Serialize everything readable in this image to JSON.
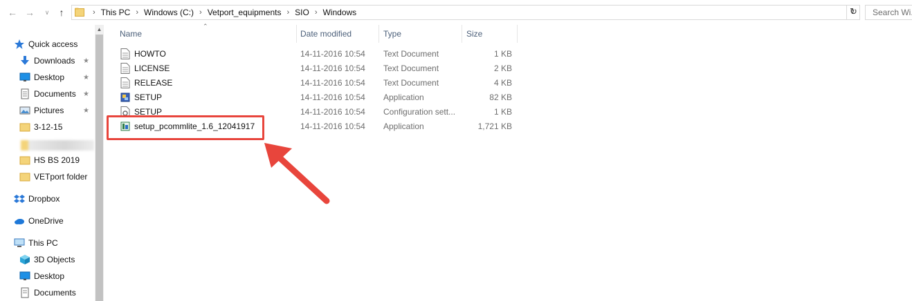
{
  "address": {
    "crumbs": [
      "This PC",
      "Windows (C:)",
      "Vetport_equipments",
      "SIO",
      "Windows"
    ],
    "search_placeholder": "Search Wi..."
  },
  "nav": {
    "quick_access": "Quick access",
    "items": [
      {
        "label": "Downloads",
        "icon": "download-icon",
        "pinned": true
      },
      {
        "label": "Desktop",
        "icon": "desktop-icon",
        "pinned": true
      },
      {
        "label": "Documents",
        "icon": "documents-icon",
        "pinned": true
      },
      {
        "label": "Pictures",
        "icon": "pictures-icon",
        "pinned": true
      },
      {
        "label": "3-12-15",
        "icon": "folder-icon",
        "pinned": false
      },
      {
        "label": "HS BS 2019",
        "icon": "folder-icon",
        "pinned": false
      },
      {
        "label": "VETport folder",
        "icon": "folder-icon",
        "pinned": false
      }
    ],
    "dropbox": "Dropbox",
    "onedrive": "OneDrive",
    "this_pc": "This PC",
    "pc_items": [
      "3D Objects",
      "Desktop",
      "Documents"
    ]
  },
  "columns": {
    "name": "Name",
    "date": "Date modified",
    "type": "Type",
    "size": "Size"
  },
  "files": [
    {
      "name": "HOWTO",
      "date": "14-11-2016 10:54",
      "type": "Text Document",
      "size": "1 KB",
      "icon": "text-file-icon"
    },
    {
      "name": "LICENSE",
      "date": "14-11-2016 10:54",
      "type": "Text Document",
      "size": "2 KB",
      "icon": "text-file-icon"
    },
    {
      "name": "RELEASE",
      "date": "14-11-2016 10:54",
      "type": "Text Document",
      "size": "4 KB",
      "icon": "text-file-icon"
    },
    {
      "name": "SETUP",
      "date": "14-11-2016 10:54",
      "type": "Application",
      "size": "82 KB",
      "icon": "setup-app-icon"
    },
    {
      "name": "SETUP",
      "date": "14-11-2016 10:54",
      "type": "Configuration sett...",
      "size": "1 KB",
      "icon": "config-file-icon"
    },
    {
      "name": "setup_pcommlite_1.6_12041917",
      "date": "14-11-2016 10:54",
      "type": "Application",
      "size": "1,721 KB",
      "icon": "installer-app-icon"
    }
  ],
  "colors": {
    "annotation": "#e8453c",
    "header_text": "#4c607a",
    "folder": "#f4d47a"
  }
}
